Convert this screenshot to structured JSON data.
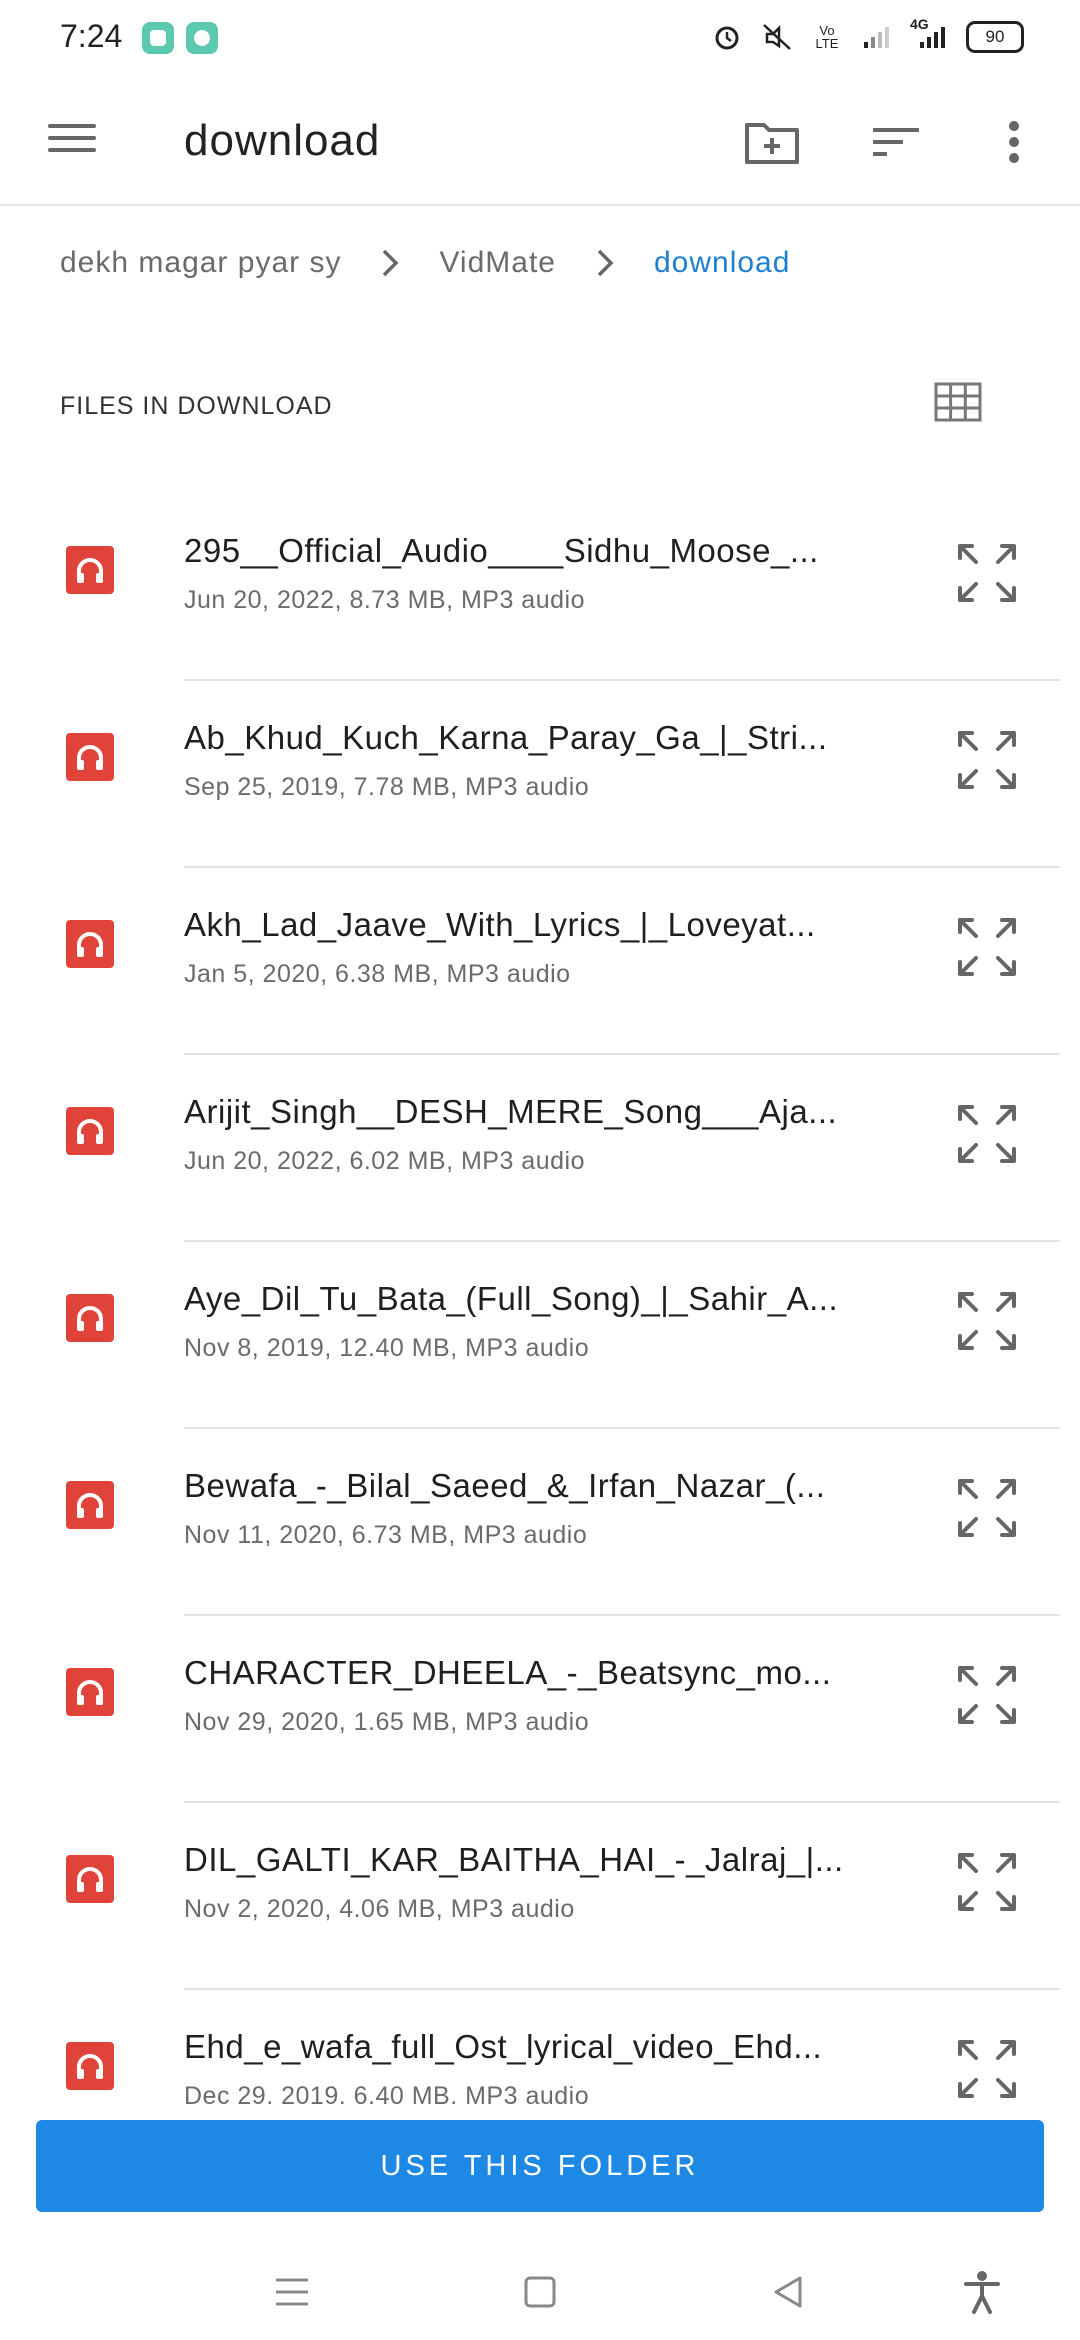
{
  "status_bar": {
    "time": "7:24",
    "network_label": "4G",
    "volte_label": "Vo LTE",
    "battery": "90"
  },
  "app_bar": {
    "title": "download"
  },
  "breadcrumb": [
    "dekh magar pyar sy",
    "VidMate",
    "download"
  ],
  "section": {
    "title": "FILES IN DOWNLOAD"
  },
  "files": [
    {
      "name": "295__Official_Audio____Sidhu_Moose_...",
      "meta": "Jun 20, 2022, 8.73 MB, MP3 audio"
    },
    {
      "name": "Ab_Khud_Kuch_Karna_Paray_Ga_|_Stri...",
      "meta": "Sep 25, 2019, 7.78 MB, MP3 audio"
    },
    {
      "name": "Akh_Lad_Jaave_With_Lyrics_|_Loveyat...",
      "meta": "Jan 5, 2020, 6.38 MB, MP3 audio"
    },
    {
      "name": "Arijit_Singh__DESH_MERE_Song___Aja...",
      "meta": "Jun 20, 2022, 6.02 MB, MP3 audio"
    },
    {
      "name": "Aye_Dil_Tu_Bata_(Full_Song)_|_Sahir_A...",
      "meta": "Nov 8, 2019, 12.40 MB, MP3 audio"
    },
    {
      "name": "Bewafa_-_Bilal_Saeed_&_Irfan_Nazar_(...",
      "meta": "Nov 11, 2020, 6.73 MB, MP3 audio"
    },
    {
      "name": "CHARACTER_DHEELA_-_Beatsync_mo...",
      "meta": "Nov 29, 2020, 1.65 MB, MP3 audio"
    },
    {
      "name": "DIL_GALTI_KAR_BAITHA_HAI_-_Jalraj_|...",
      "meta": "Nov 2, 2020, 4.06 MB, MP3 audio"
    },
    {
      "name": "Ehd_e_wafa_full_Ost_lyrical_video_Ehd...",
      "meta": "Dec 29, 2019, 6.40 MB, MP3 audio"
    }
  ],
  "footer": {
    "use_folder_label": "USE THIS FOLDER"
  },
  "icons": {
    "file_icon": "headphones-icon",
    "file_icon_color": "#e0433a",
    "accent": "#1e88e5",
    "breadcrumb_active_color": "#1d7fd2"
  }
}
